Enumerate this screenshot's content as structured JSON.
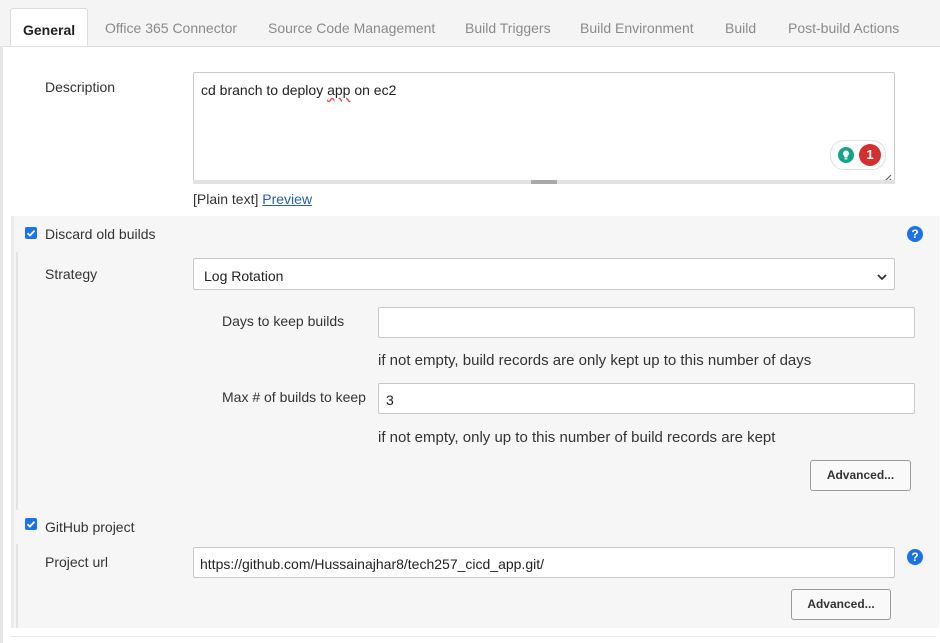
{
  "tabs": [
    {
      "label": "General"
    },
    {
      "label": "Office 365 Connector"
    },
    {
      "label": "Source Code Management"
    },
    {
      "label": "Build Triggers"
    },
    {
      "label": "Build Environment"
    },
    {
      "label": "Build"
    },
    {
      "label": "Post-build Actions"
    }
  ],
  "description": {
    "label": "Description",
    "text_before": "cd branch to deploy ",
    "text_flagged": "app",
    "text_after": " on ec2",
    "grammar_badge_count": "1",
    "format_label": "[Plain text]",
    "preview_link": "Preview"
  },
  "discard_builds": {
    "checkbox_label": "Discard old builds",
    "checked": true,
    "strategy_label": "Strategy",
    "strategy_value": "Log Rotation",
    "days_label": "Days to keep builds",
    "days_value": "",
    "days_hint": "if not empty, build records are only kept up to this number of days",
    "max_label": "Max # of builds to keep",
    "max_value": "3",
    "max_hint": "if not empty, only up to this number of build records are kept",
    "advanced_label": "Advanced..."
  },
  "github": {
    "checkbox_label": "GitHub project",
    "checked": true,
    "url_label": "Project url",
    "url_value": "https://github.com/Hussainajhar8/tech257_cicd_app.git/",
    "advanced_label": "Advanced..."
  },
  "help_glyph": "?",
  "colors": {
    "accent": "#1a73e8",
    "badge_red": "#d32f2f",
    "badge_green": "#15a28a"
  }
}
